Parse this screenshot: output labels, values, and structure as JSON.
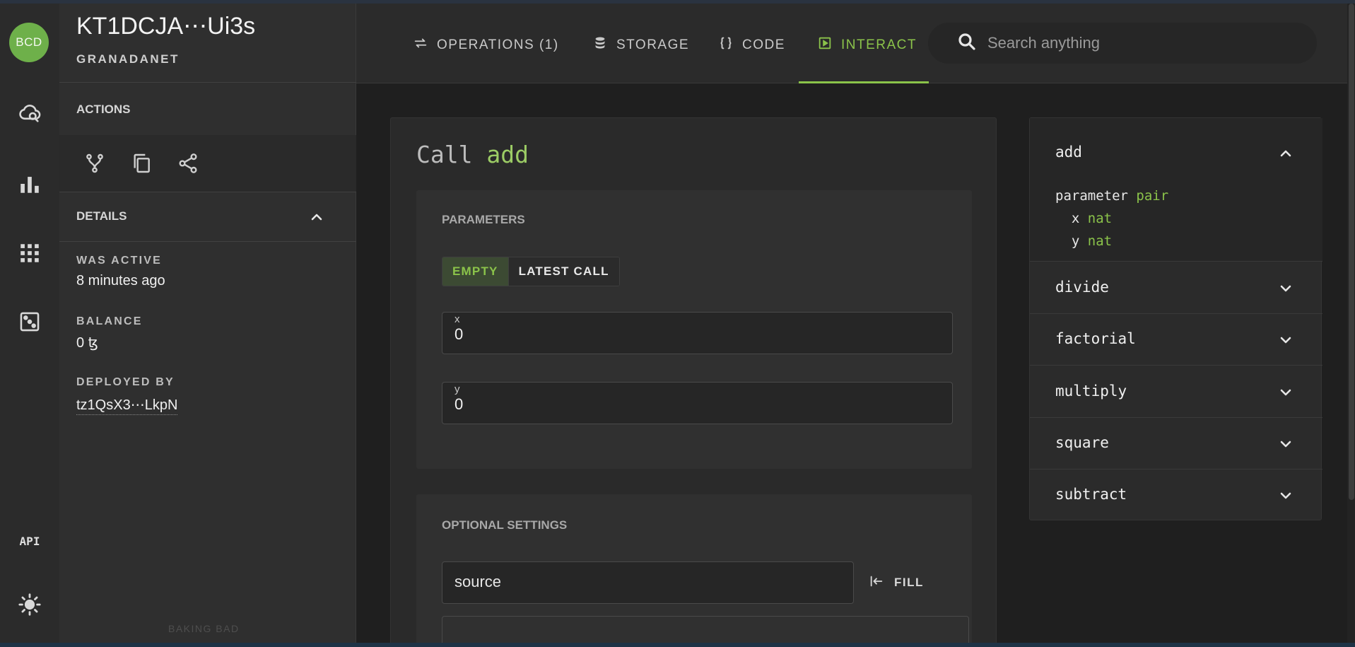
{
  "app": {
    "logo_text": "BCD",
    "api_label": "API",
    "footer": "BAKING BAD"
  },
  "contract": {
    "address": "KT1DCJA⋯Ui3s",
    "network": "GRANADANET"
  },
  "actions": {
    "heading": "ACTIONS"
  },
  "details": {
    "heading": "DETAILS",
    "was_active_label": "WAS ACTIVE",
    "was_active_value": "8 minutes ago",
    "balance_label": "BALANCE",
    "balance_value": "0 ꜩ",
    "deployed_by_label": "DEPLOYED BY",
    "deployed_by_value": "tz1QsX3⋯LkpN"
  },
  "tabs": [
    {
      "label": "OPERATIONS (1)",
      "icon": "swap-arrows-icon",
      "active": false
    },
    {
      "label": "STORAGE",
      "icon": "database-icon",
      "active": false
    },
    {
      "label": "CODE",
      "icon": "braces-icon",
      "active": false
    },
    {
      "label": "INTERACT",
      "icon": "play-box-icon",
      "active": true
    }
  ],
  "search": {
    "placeholder": "Search anything"
  },
  "call": {
    "prefix": "Call",
    "entrypoint": "add",
    "parameters_heading": "PARAMETERS",
    "toggle_empty": "EMPTY",
    "toggle_latest": "LATEST CALL",
    "fields": [
      {
        "label": "x",
        "value": "0"
      },
      {
        "label": "y",
        "value": "0"
      }
    ],
    "optional_heading": "OPTIONAL SETTINGS",
    "source_placeholder": "source",
    "fill_label": "FILL"
  },
  "entrypoints": {
    "open": {
      "name": "add",
      "param_keyword": "parameter",
      "param_type": "pair",
      "args": [
        {
          "name": "x",
          "type": "nat"
        },
        {
          "name": "y",
          "type": "nat"
        }
      ]
    },
    "collapsed": [
      "divide",
      "factorial",
      "multiply",
      "square",
      "subtract"
    ]
  },
  "colors": {
    "accent": "#8bc34a",
    "background": "#1f1f1f",
    "panel": "#2f2f2f",
    "avatar": "#6eb04a"
  }
}
